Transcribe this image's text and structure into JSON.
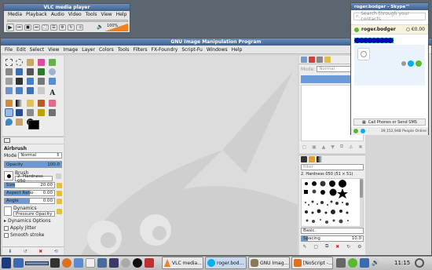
{
  "vlc": {
    "title": "VLC media player",
    "menu": [
      "Media",
      "Playback",
      "Audio",
      "Video",
      "Tools",
      "View",
      "Help"
    ],
    "volume_label": "100%"
  },
  "skype": {
    "title": "roger.bodger - Skype™",
    "search_placeholder": "Search through your contacts",
    "username": "roger.bodger",
    "credit": "€0.00",
    "call_phones_label": "Call Phones or Send SMS",
    "online_status": "39,152,948 People Online"
  },
  "gimp": {
    "title": "GNU Image Manipulation Program",
    "menu": [
      "File",
      "Edit",
      "Select",
      "View",
      "Image",
      "Layer",
      "Colors",
      "Tools",
      "Filters",
      "FX-Foundry",
      "Script-Fu",
      "Windows",
      "Help"
    ],
    "tool_options": {
      "tool_name": "Airbrush",
      "mode_label": "Mode",
      "mode_value": "Normal",
      "opacity_label": "Opacity",
      "opacity_value": "100.0",
      "brush_label": "Brush",
      "brush_value": "2. Hardness 050",
      "size_label": "Size",
      "size_value": "20.00",
      "aspect_label": "Aspect Ratio",
      "aspect_value": "0.00",
      "angle_label": "Angle",
      "angle_value": "0.00",
      "dynamics_label": "Dynamics",
      "dynamics_value": "Pressure Opacity",
      "dynamics_options": "Dynamics Options",
      "apply_jitter": "Apply Jitter",
      "smooth_stroke": "Smooth stroke"
    },
    "layers": {
      "mode_label": "Mode:",
      "mode_value": "Normal"
    },
    "brushes": {
      "filter_placeholder": "filter",
      "selected_brush": "2. Hardness 050 (51 × 51)",
      "preset_value": "Basic.",
      "spacing_label": "Spacing",
      "spacing_value": "10.0"
    }
  },
  "taskbar": {
    "items": [
      {
        "label": "VLC media..."
      },
      {
        "label": "roger.bod..."
      },
      {
        "label": "GNU Imag..."
      },
      {
        "label": "[NoScript -..."
      }
    ],
    "clock": "11:15"
  },
  "colors": {
    "titlebar": "#4a6e9c",
    "panel_bg": "#ececec",
    "accent": "#6a9bd6",
    "skype_blue": "#00aff0",
    "skype_green": "#5ab82f",
    "desktop": "#5c6670"
  }
}
